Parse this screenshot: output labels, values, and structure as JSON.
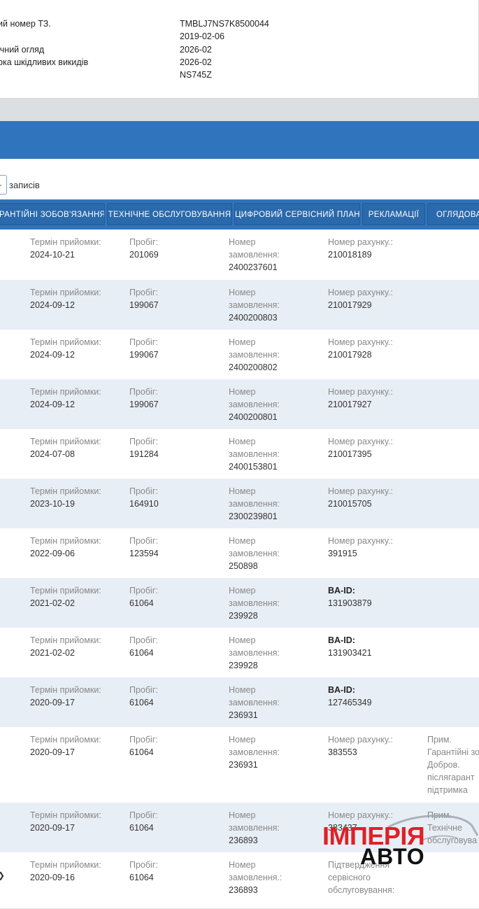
{
  "vehicle": {
    "rows": [
      {
        "label": "ий номер ТЗ.",
        "value": "TMBLJ7NS7K8500044"
      },
      {
        "label": "",
        "value": "2019-02-06"
      },
      {
        "label": "ічний огляд",
        "value": "2026-02"
      },
      {
        "label": "рка шкідливих викидів",
        "value": "2026-02"
      },
      {
        "label": "",
        "value": "NS745Z"
      }
    ]
  },
  "table_controls": {
    "page_size": "",
    "records_label": "записів"
  },
  "tabs": [
    "АРАНТІЙНІ ЗОБОВ'ЯЗАННЯ",
    "ТЕХНІЧНЕ ОБСЛУГОВУВАННЯ",
    "ЦИФРОВИЙ СЕРВІСНИЙ ПЛАН",
    "РЕКЛАМАЦІЇ",
    "ОГЛЯДОВА КАР"
  ],
  "records": [
    {
      "c1_label": "Термін прийомки:",
      "c1_value": "2024-10-21",
      "c2_label": "Пробіг:",
      "c2_value": "201069",
      "c3_label": "Номер замовлення:",
      "c3_value": "2400237601",
      "c4_label": "Номер рахунку.:",
      "c4_value": "210018189",
      "c5_label": "",
      "c5_value": ""
    },
    {
      "c1_label": "Термін прийомки:",
      "c1_value": "2024-09-12",
      "c2_label": "Пробіг:",
      "c2_value": "199067",
      "c3_label": "Номер замовлення:",
      "c3_value": "2400200803",
      "c4_label": "Номер рахунку.:",
      "c4_value": "210017929",
      "c5_label": "",
      "c5_value": ""
    },
    {
      "c1_label": "Термін прийомки:",
      "c1_value": "2024-09-12",
      "c2_label": "Пробіг:",
      "c2_value": "199067",
      "c3_label": "Номер замовлення:",
      "c3_value": "2400200802",
      "c4_label": "Номер рахунку.:",
      "c4_value": "210017928",
      "c5_label": "",
      "c5_value": ""
    },
    {
      "c1_label": "Термін прийомки:",
      "c1_value": "2024-09-12",
      "c2_label": "Пробіг:",
      "c2_value": "199067",
      "c3_label": "Номер замовлення:",
      "c3_value": "2400200801",
      "c4_label": "Номер рахунку.:",
      "c4_value": "210017927",
      "c5_label": "",
      "c5_value": ""
    },
    {
      "c1_label": "Термін прийомки:",
      "c1_value": "2024-07-08",
      "c2_label": "Пробіг:",
      "c2_value": "191284",
      "c3_label": "Номер замовлення:",
      "c3_value": "2400153801",
      "c4_label": "Номер рахунку.:",
      "c4_value": "210017395",
      "c5_label": "",
      "c5_value": ""
    },
    {
      "c1_label": "Термін прийомки:",
      "c1_value": "2023-10-19",
      "c2_label": "Пробіг:",
      "c2_value": "164910",
      "c3_label": "Номер замовлення:",
      "c3_value": "2300239801",
      "c4_label": "Номер рахунку.:",
      "c4_value": "210015705",
      "c5_label": "",
      "c5_value": ""
    },
    {
      "c1_label": "Термін прийомки:",
      "c1_value": "2022-09-06",
      "c2_label": "Пробіг:",
      "c2_value": "123594",
      "c3_label": "Номер замовлення:",
      "c3_value": "250898",
      "c4_label": "Номер рахунку.:",
      "c4_value": "391915",
      "c5_label": "",
      "c5_value": ""
    },
    {
      "c1_label": "Термін прийомки:",
      "c1_value": "2021-02-02",
      "c2_label": "Пробіг:",
      "c2_value": "61064",
      "c3_label": "Номер замовлення:",
      "c3_value": "239928",
      "c4_label": "BA-ID:",
      "c4_value": "131903879",
      "c5_label": "",
      "c5_value": "",
      "c4_bold": true
    },
    {
      "c1_label": "Термін прийомки:",
      "c1_value": "2021-02-02",
      "c2_label": "Пробіг:",
      "c2_value": "61064",
      "c3_label": "Номер замовлення:",
      "c3_value": "239928",
      "c4_label": "BA-ID:",
      "c4_value": "131903421",
      "c5_label": "",
      "c5_value": "",
      "c4_bold": true
    },
    {
      "c1_label": "Термін прийомки:",
      "c1_value": "2020-09-17",
      "c2_label": "Пробіг:",
      "c2_value": "61064",
      "c3_label": "Номер замовлення:",
      "c3_value": "236931",
      "c4_label": "BA-ID:",
      "c4_value": "127465349",
      "c5_label": "",
      "c5_value": "",
      "c4_bold": true
    },
    {
      "c1_label": "Термін прийомки:",
      "c1_value": "2020-09-17",
      "c2_label": "Пробіг:",
      "c2_value": "61064",
      "c3_label": "Номер замовлення:",
      "c3_value": "236931",
      "c4_label": "Номер рахунку.:",
      "c4_value": "383553",
      "c5_label": "Прим.",
      "c5_value": "Гарантійні зо Добров. післягарант підтримка"
    },
    {
      "c1_label": "Термін прийомки:",
      "c1_value": "2020-09-17",
      "c2_label": "Пробіг:",
      "c2_value": "61064",
      "c3_label": "Номер замовлення:",
      "c3_value": "236893",
      "c4_label": "Номер рахунку.:",
      "c4_value": "383437",
      "c5_label": "Прим.",
      "c5_value": "Технічне обслуговува"
    },
    {
      "c1_label": "Термін прийомки:",
      "c1_value": "2020-09-16",
      "c2_label": "Пробіг:",
      "c2_value": "61064",
      "c3_label": "Номер замовлення.:",
      "c3_value": "236893",
      "c4_label": "Підтвердження сервісного обслуговування:",
      "c4_value": "",
      "c5_label": "",
      "c5_value": ""
    }
  ],
  "watermark": {
    "line1": "ІМПЕРІЯ",
    "line2": "АВТО"
  },
  "colors": {
    "primary": "#2f74bd",
    "row_alt": "#e8eef5",
    "logo_red": "#e02027"
  }
}
